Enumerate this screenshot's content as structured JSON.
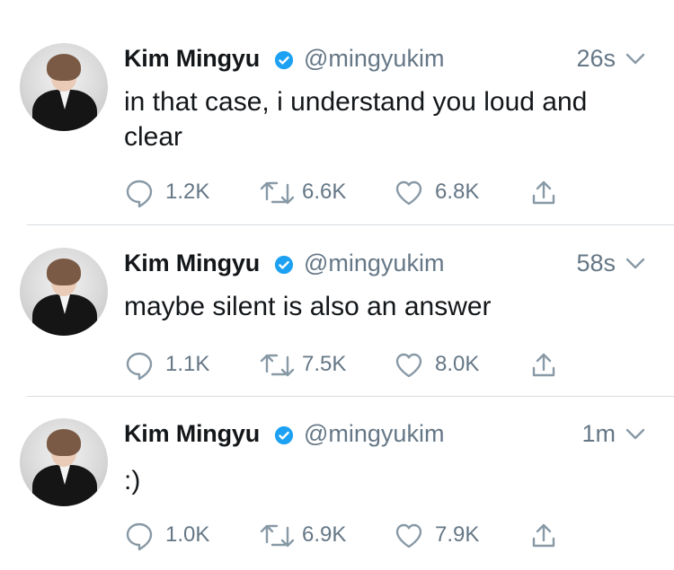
{
  "tweets": [
    {
      "name": "Kim Mingyu",
      "handle": "@mingyukim",
      "time": "26s",
      "text": "in that case, i understand you loud and clear",
      "replies": "1.2K",
      "retweets": "6.6K",
      "likes": "6.8K"
    },
    {
      "name": "Kim Mingyu",
      "handle": "@mingyukim",
      "time": "58s",
      "text": "maybe silent is also an answer",
      "replies": "1.1K",
      "retweets": "7.5K",
      "likes": "8.0K"
    },
    {
      "name": "Kim Mingyu",
      "handle": "@mingyukim",
      "time": "1m",
      "text": ":)",
      "replies": "1.0K",
      "retweets": "6.9K",
      "likes": "7.9K"
    }
  ],
  "icons": {
    "verified": "verified-badge-icon",
    "menu": "chevron-down-icon",
    "reply": "reply-icon",
    "retweet": "retweet-icon",
    "like": "heart-icon",
    "share": "share-icon"
  },
  "colors": {
    "verified": "#1da1f2",
    "secondary_text": "#657786",
    "primary_text": "#14171a",
    "divider": "#d8dde1"
  }
}
